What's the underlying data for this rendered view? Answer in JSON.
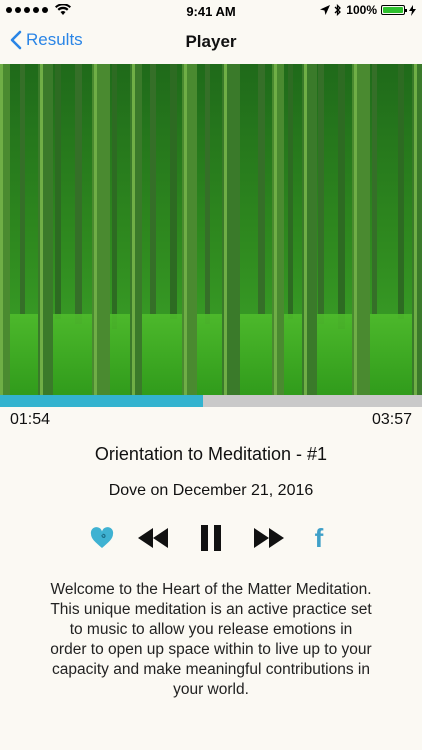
{
  "status_bar": {
    "time": "9:41 AM",
    "battery_percent": "100%",
    "signal_dots": 5,
    "battery_color": "#2ec02e"
  },
  "nav": {
    "back_label": "Results",
    "title": "Player",
    "accent": "#2a85e6"
  },
  "player": {
    "elapsed": "01:54",
    "total": "03:57",
    "progress_fraction": 0.48,
    "progress_color": "#33b3cf",
    "track_title": "Orientation to Meditation - #1",
    "track_meta": "Dove on December 21, 2016",
    "controls": [
      {
        "name": "favorite",
        "icon": "heart-icon"
      },
      {
        "name": "rewind",
        "icon": "rewind-icon"
      },
      {
        "name": "pause",
        "icon": "pause-icon"
      },
      {
        "name": "fast-forward",
        "icon": "fast-forward-icon"
      },
      {
        "name": "share-facebook",
        "icon": "facebook-icon",
        "label": "f"
      }
    ],
    "description": "Welcome to the Heart of the Matter Meditation. This unique meditation is an active practice set to music to allow you release emotions in order to open up space within to live up to your capacity and make meaningful contributions in your world."
  }
}
